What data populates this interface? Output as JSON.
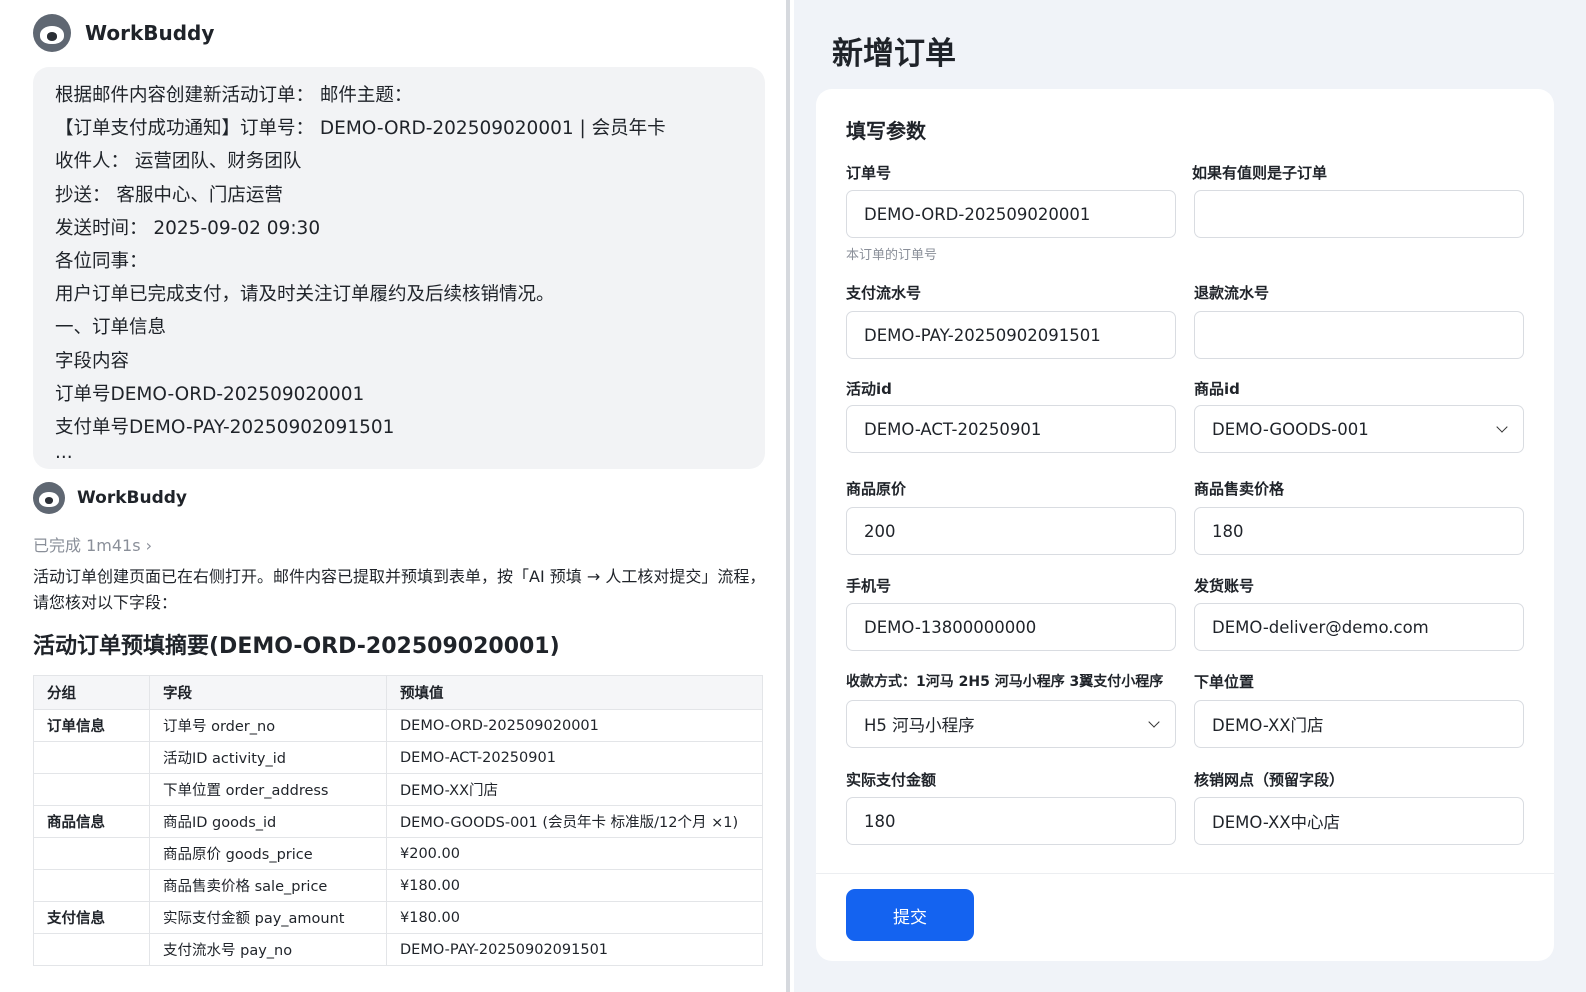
{
  "chat": {
    "bot_name": "WorkBuddy",
    "user_message_lines": [
      "根据邮件内容创建新活动订单： 邮件主题：",
      "【订单支付成功通知】订单号： DEMO-ORD-202509020001 | 会员年卡",
      "收件人： 运营团队、财务团队",
      "抄送： 客服中心、门店运营",
      "发送时间： 2025-09-02 09:30",
      "各位同事：",
      "用户订单已完成支付，请及时关注订单履约及后续核销情况。",
      "一、订单信息",
      "字段内容",
      "订单号DEMO-ORD-202509020001",
      "支付单号DEMO-PAY-20250902091501",
      "..."
    ],
    "status": "已完成 1m41s ›",
    "reply_text": "活动订单创建页面已在右侧打开。邮件内容已提取并预填到表单，按「AI 预填 → 人工核对提交」流程，请您核对以下字段：",
    "summary_title": "活动订单预填摘要(DEMO-ORD-202509020001)",
    "table": {
      "headers": [
        "分组",
        "字段",
        "预填值"
      ],
      "rows": [
        [
          "订单信息",
          "订单号 order_no",
          "DEMO-ORD-202509020001"
        ],
        [
          "",
          "活动ID activity_id",
          "DEMO-ACT-20250901"
        ],
        [
          "",
          "下单位置 order_address",
          "DEMO-XX门店"
        ],
        [
          "商品信息",
          "商品ID goods_id",
          "DEMO-GOODS-001 (会员年卡 标准版/12个月 ×1)"
        ],
        [
          "",
          "商品原价 goods_price",
          "¥200.00"
        ],
        [
          "",
          "商品售卖价格 sale_price",
          "¥180.00"
        ],
        [
          "支付信息",
          "实际支付金额 pay_amount",
          "¥180.00"
        ],
        [
          "",
          "支付流水号 pay_no",
          "DEMO-PAY-20250902091501"
        ]
      ]
    }
  },
  "form": {
    "page_title": "新增订单",
    "card_title": "填写参数",
    "fields": {
      "order_no": {
        "label": "订单号",
        "value": "DEMO-ORD-202509020001",
        "hint": "本订单的订单号"
      },
      "sub_order": {
        "label": "如果有值则是子订单",
        "value": ""
      },
      "pay_no": {
        "label": "支付流水号",
        "value": "DEMO-PAY-20250902091501"
      },
      "refund_no": {
        "label": "退款流水号",
        "value": ""
      },
      "activity_id": {
        "label": "活动id",
        "value": "DEMO-ACT-20250901"
      },
      "goods_id": {
        "label": "商品id",
        "value": "DEMO-GOODS-001"
      },
      "goods_price": {
        "label": "商品原价",
        "value": "200"
      },
      "sale_price": {
        "label": "商品售卖价格",
        "value": "180"
      },
      "phone": {
        "label": "手机号",
        "value": "DEMO-13800000000"
      },
      "deliver_account": {
        "label": "发货账号",
        "value": "DEMO-deliver@demo.com"
      },
      "pay_method": {
        "label": "收款方式：1河马 2H5 河马小程序 3翼支付小程序",
        "value": "H5 河马小程序"
      },
      "order_address": {
        "label": "下单位置",
        "value": "DEMO-XX门店"
      },
      "pay_amount": {
        "label": "实际支付金额",
        "value": "180"
      },
      "verify_point": {
        "label": "核销网点（预留字段）",
        "value": "DEMO-XX中心店"
      }
    },
    "submit_label": "提交"
  },
  "colors": {
    "primary": "#1463f0",
    "panel_bg": "#f0f3f8",
    "bubble_bg": "#f2f3f5"
  }
}
